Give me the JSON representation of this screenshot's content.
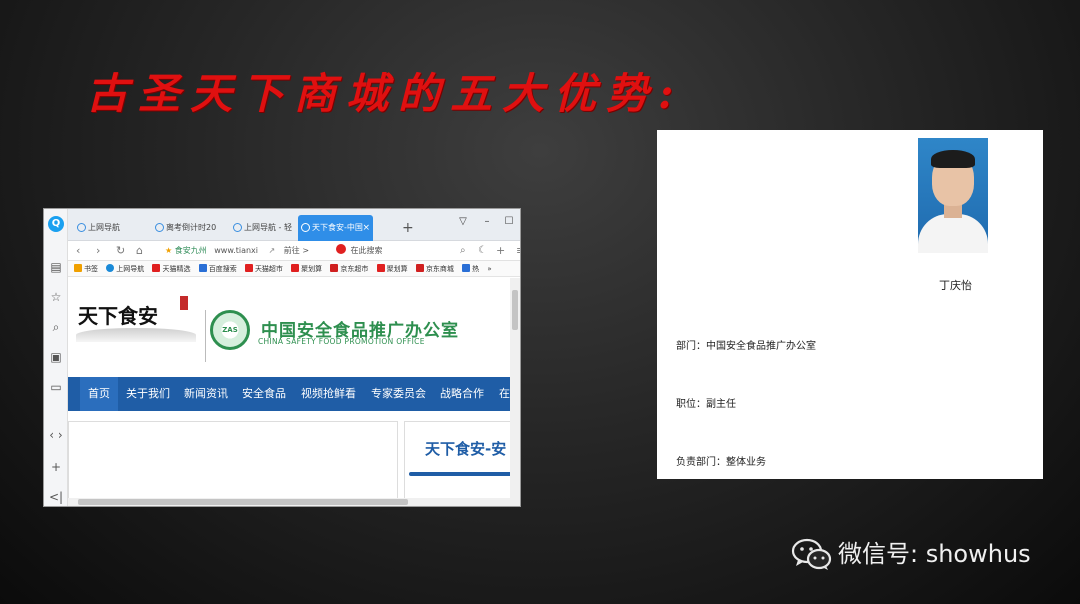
{
  "slide": {
    "title": "古圣天下商城的五大优势:"
  },
  "browser": {
    "tabs": [
      {
        "label": "上网导航"
      },
      {
        "label": "离考倒计时20"
      },
      {
        "label": "上网导航 - 轻"
      },
      {
        "label": "天下食安-中国"
      }
    ],
    "tab_close": "×",
    "tab_add": "+",
    "address": {
      "site_name": "食安九州",
      "url": "www.tianxi",
      "forward_hint": "前往 >",
      "search_hint": "在此搜索"
    },
    "bookmarks": [
      {
        "label": "书签",
        "color": "#f0a000"
      },
      {
        "label": "上网导航",
        "color": "#1a8ad8"
      },
      {
        "label": "天猫精选",
        "color": "#e02020"
      },
      {
        "label": "百度搜索",
        "color": "#2a6fd6"
      },
      {
        "label": "天猫超市",
        "color": "#e02020"
      },
      {
        "label": "聚划算",
        "color": "#e02020"
      },
      {
        "label": "京东超市",
        "color": "#d02020"
      },
      {
        "label": "聚划算",
        "color": "#e02020"
      },
      {
        "label": "京东商城",
        "color": "#d02020"
      },
      {
        "label": "热",
        "color": "#2a6fd6"
      }
    ],
    "bookmarks_more": "»",
    "page": {
      "logo_text": "天下食安",
      "emblem_text": "ZAS",
      "org_cn": "中国安全食品推广办公室",
      "org_en": "CHINA SAFETY FOOD PROMOTION OFFICE",
      "nav": [
        "首页",
        "关于我们",
        "新闻资讯",
        "安全食品",
        "视频抢鲜看",
        "专家委员会",
        "战略合作",
        "在"
      ],
      "banner_title": "天下食安-安"
    }
  },
  "profile": {
    "name": "丁庆怡",
    "department": "部门：中国安全食品推广办公室",
    "position": "职位：副主任",
    "responsible": "负责部门：整体业务"
  },
  "watermark": {
    "text": "微信号: showhus"
  }
}
